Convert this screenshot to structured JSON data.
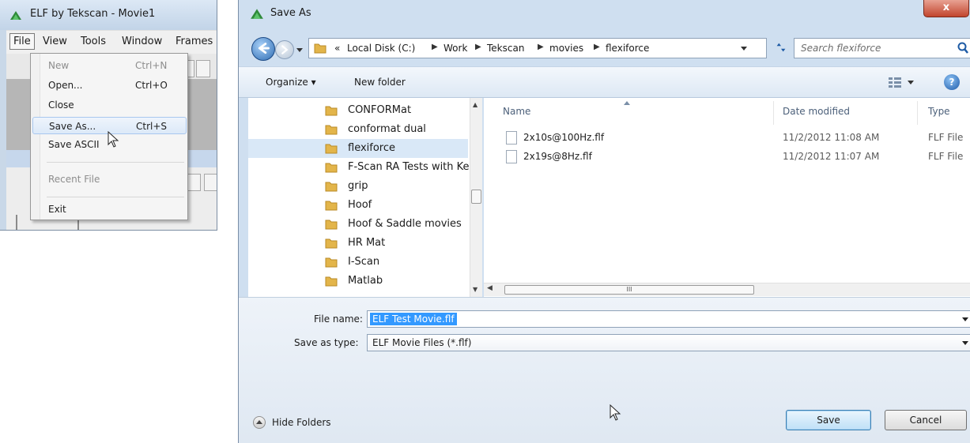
{
  "elf_window": {
    "title": "ELF by Tekscan - Movie1",
    "menubar": [
      "File",
      "View",
      "Tools",
      "Window",
      "Frames"
    ],
    "file_menu": {
      "items": [
        {
          "label": "New",
          "shortcut": "Ctrl+N",
          "disabled": true
        },
        {
          "label": "Open...",
          "shortcut": "Ctrl+O",
          "disabled": false
        },
        {
          "label": "Close",
          "shortcut": "",
          "disabled": false
        },
        {
          "label": "Save As...",
          "shortcut": "Ctrl+S",
          "disabled": false,
          "highlighted": true
        },
        {
          "label": "Save ASCII",
          "shortcut": "",
          "disabled": false
        },
        {
          "label": "Recent File",
          "shortcut": "",
          "disabled": true
        },
        {
          "label": "Exit",
          "shortcut": "",
          "disabled": false
        }
      ]
    }
  },
  "dialog": {
    "title": "Save As",
    "close_label": "x",
    "breadcrumb": [
      "«",
      "Local Disk (C:)",
      "Work",
      "Tekscan",
      "movies",
      "flexiforce"
    ],
    "search_placeholder": "Search flexiforce",
    "organize_label": "Organize ▾",
    "new_folder_label": "New folder",
    "help_label": "?",
    "folders": [
      {
        "name": "CONFORMat",
        "selected": false
      },
      {
        "name": "conformat dual",
        "selected": false
      },
      {
        "name": "flexiforce",
        "selected": true
      },
      {
        "name": "F-Scan RA Tests with Ker",
        "selected": false
      },
      {
        "name": "grip",
        "selected": false
      },
      {
        "name": "Hoof",
        "selected": false
      },
      {
        "name": "Hoof & Saddle movies",
        "selected": false
      },
      {
        "name": "HR Mat",
        "selected": false
      },
      {
        "name": "I-Scan",
        "selected": false
      },
      {
        "name": "Matlab",
        "selected": false
      }
    ],
    "columns": {
      "name": "Name",
      "date": "Date modified",
      "type": "Type"
    },
    "files": [
      {
        "name": "2x10s@100Hz.flf",
        "date": "11/2/2012 11:08 AM",
        "type": "FLF File"
      },
      {
        "name": "2x19s@8Hz.flf",
        "date": "11/2/2012 11:07 AM",
        "type": "FLF File"
      }
    ],
    "hscroll_grip": "III",
    "file_name_label": "File name:",
    "file_name_value": "ELF Test Movie.flf",
    "save_type_label": "Save as type:",
    "save_type_value": "ELF Movie Files (*.flf)",
    "hide_folders_label": "Hide Folders",
    "save_label": "Save",
    "cancel_label": "Cancel"
  },
  "colors": {
    "accent": "#3399ff",
    "frame": "#cfdff0",
    "menu_highlight": "#dce9f8",
    "folder": "#e3b54a"
  }
}
